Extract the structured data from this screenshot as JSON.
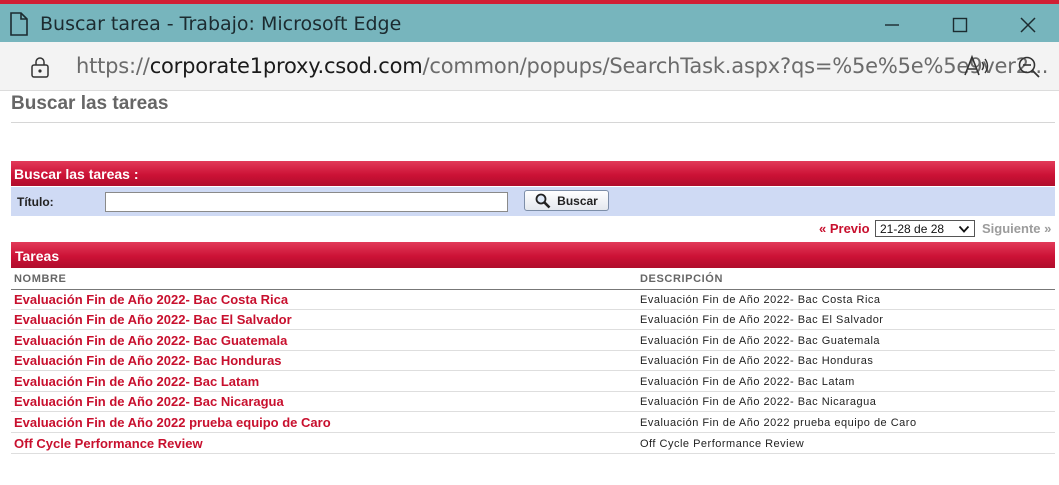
{
  "window": {
    "title": "Buscar tarea - Trabajo: Microsoft Edge",
    "url_prefix": "https://",
    "url_host": "corporate1proxy.csod.com",
    "url_rest": "/common/popups/SearchTask.aspx?qs=%5e%5e%5e9ver2..."
  },
  "page": {
    "title": "Buscar las tareas"
  },
  "search": {
    "header": "Buscar las tareas :",
    "title_label": "Título:",
    "title_value": "",
    "button_label": "Buscar"
  },
  "pager": {
    "prev_label": "« Previo",
    "range_selected": "21-28 de 28",
    "next_label": "Siguiente »"
  },
  "tasks": {
    "header": "Tareas",
    "col_name": "NOMBRE",
    "col_desc": "DESCRIPCIÓN",
    "rows": [
      {
        "name": "Evaluación Fin de Año 2022- Bac Costa Rica",
        "desc": "Evaluación Fin de Año 2022- Bac Costa Rica"
      },
      {
        "name": "Evaluación Fin de Año 2022- Bac El Salvador",
        "desc": "Evaluación Fin de Año 2022- Bac El Salvador"
      },
      {
        "name": "Evaluación Fin de Año 2022- Bac Guatemala",
        "desc": "Evaluación Fin de Año 2022- Bac Guatemala"
      },
      {
        "name": "Evaluación Fin de Año 2022- Bac Honduras",
        "desc": "Evaluación Fin de Año 2022- Bac Honduras"
      },
      {
        "name": "Evaluación Fin de Año 2022- Bac Latam",
        "desc": "Evaluación Fin de Año 2022- Bac Latam"
      },
      {
        "name": "Evaluación Fin de Año 2022- Bac Nicaragua",
        "desc": "Evaluación Fin de Año 2022- Bac Nicaragua"
      },
      {
        "name": "Evaluación Fin de Año 2022 prueba equipo de Caro",
        "desc": "Evaluación Fin de Año 2022 prueba equipo de Caro"
      },
      {
        "name": "Off Cycle Performance Review",
        "desc": "Off Cycle Performance Review"
      }
    ]
  },
  "colors": {
    "titlebar": "#77b5bd",
    "header_red": "#cc1236",
    "link_red": "#c8102e",
    "search_row": "#cfdaf4"
  }
}
